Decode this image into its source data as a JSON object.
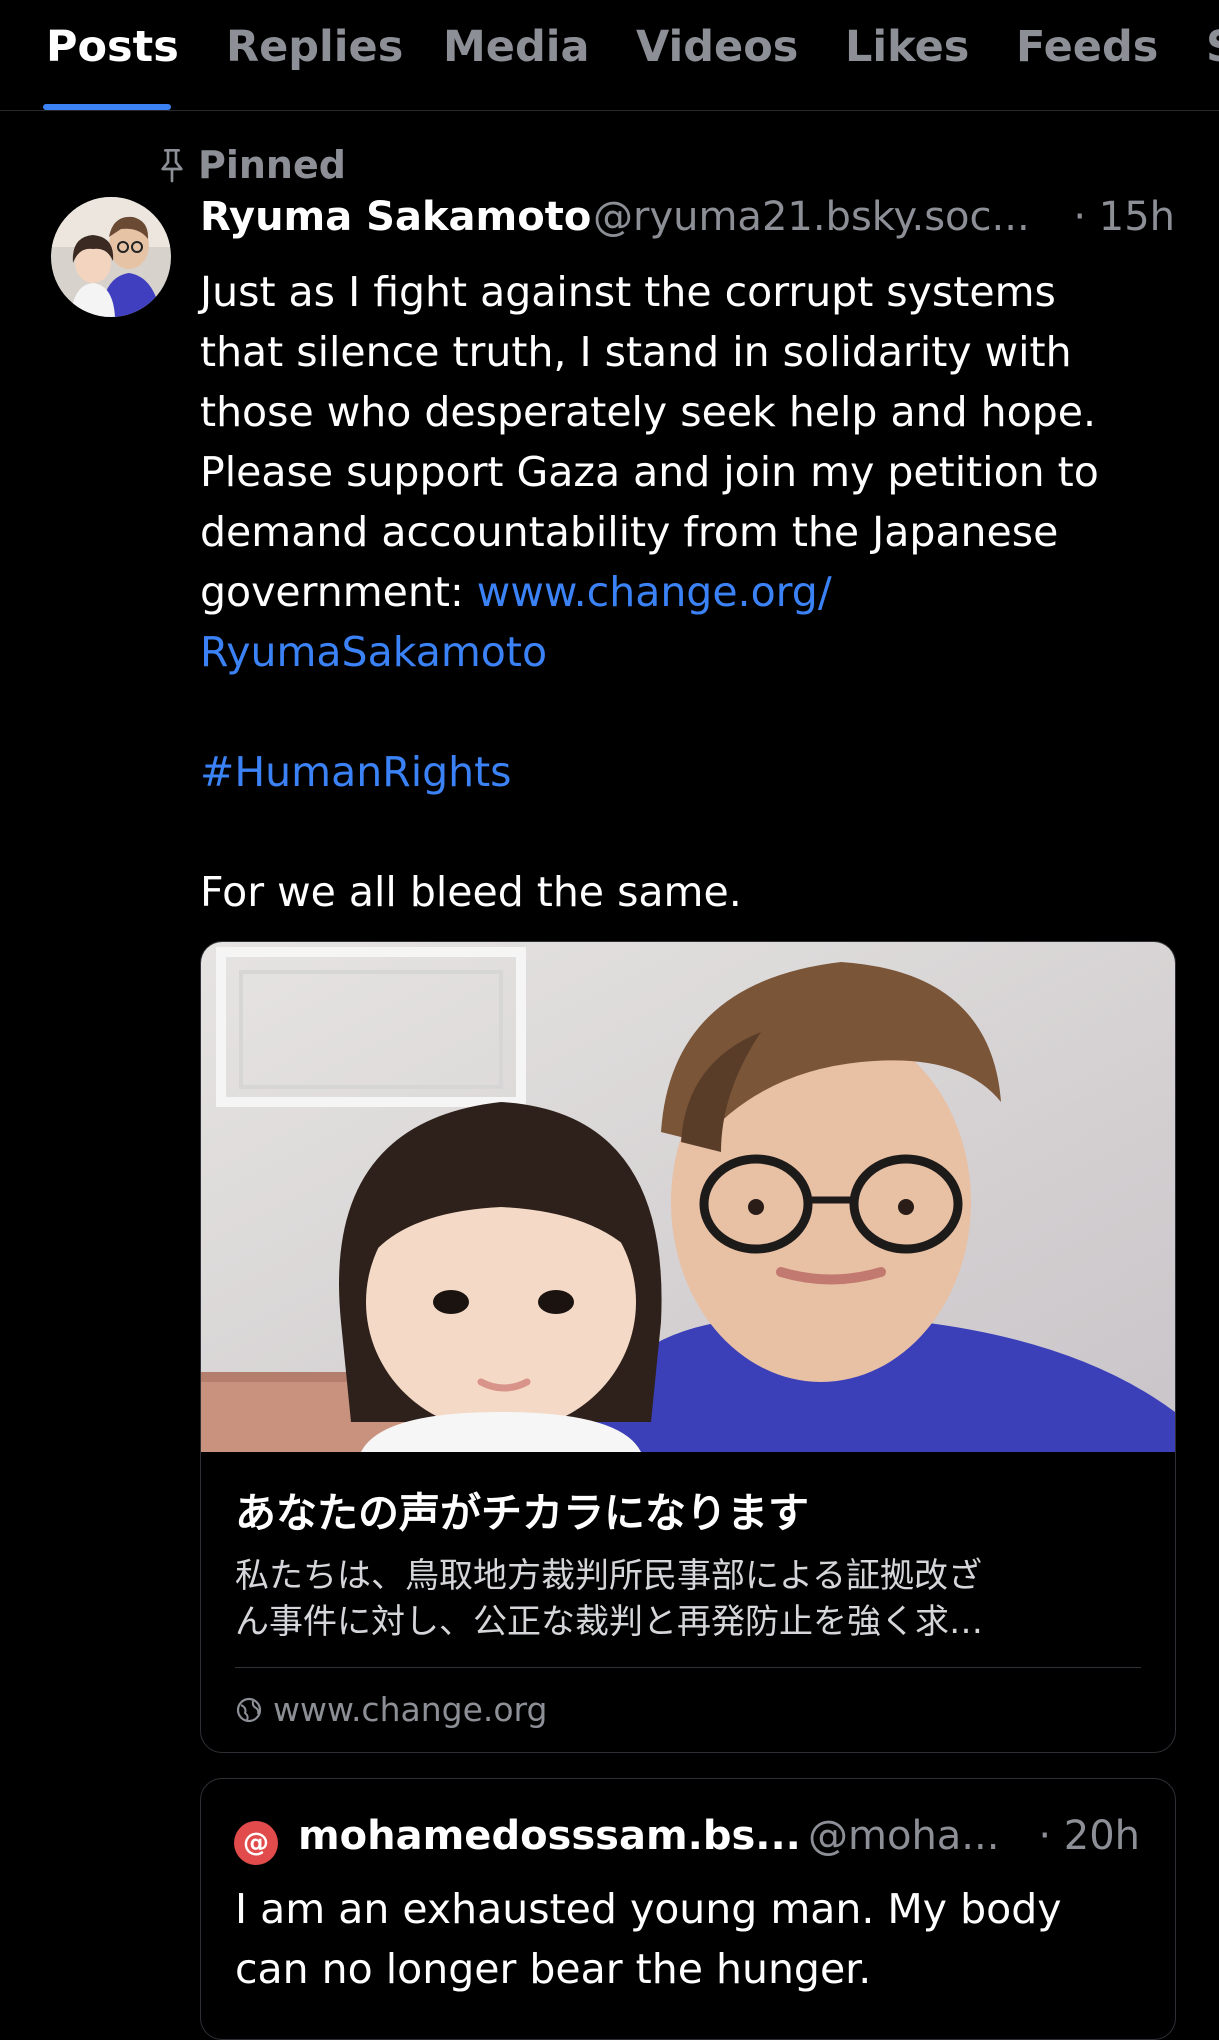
{
  "tabs": [
    {
      "label": "Posts",
      "active": true
    },
    {
      "label": "Replies",
      "active": false
    },
    {
      "label": "Media",
      "active": false
    },
    {
      "label": "Videos",
      "active": false
    },
    {
      "label": "Likes",
      "active": false
    },
    {
      "label": "Feeds",
      "active": false
    },
    {
      "label": "S",
      "active": false
    }
  ],
  "pinned_label": "Pinned",
  "post": {
    "author_name": "Ryuma Sakamoto",
    "author_handle": "@ryuma21.bsky.soc...",
    "time": "· 15h",
    "body_lines": [
      "Just as I fight against the corrupt systems",
      "that silence truth, I stand in solidarity with",
      "those who desperately seek help and hope.",
      "Please support Gaza and join my petition to",
      "demand accountability from the Japanese"
    ],
    "body_line_6_text": "government: ",
    "link_part1": "www.change.org/",
    "link_part2": "RyumaSakamoto",
    "hashtag": "#HumanRights",
    "closing": "For we all bleed the same."
  },
  "card": {
    "title": "あなたの声がチカラになります",
    "desc_line1": "私たちは、鳥取地方裁判所民事部による証拠改ざ",
    "desc_line2": "ん事件に対し、公正な裁判と再発防止を強く求…",
    "domain": "www.change.org"
  },
  "quote": {
    "avatar_glyph": "@",
    "author_name": "mohamedosssam.bs...",
    "author_handle": "@moha...",
    "time": "· 20h",
    "body_line1": "I am an exhausted young man. My body",
    "body_line2": "can no longer bear the hunger."
  },
  "colors": {
    "background": "#000000",
    "accent": "#3b82f6",
    "muted": "#8c8f96",
    "quote_avatar": "#e14b4b"
  }
}
